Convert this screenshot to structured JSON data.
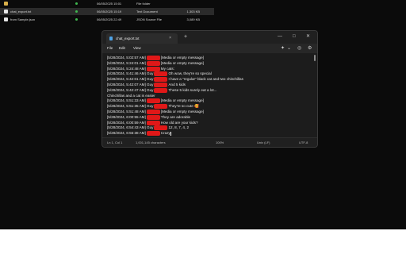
{
  "explorer": {
    "files": [
      {
        "name": "",
        "date": "06/05/2025 15:01",
        "type": "File folder",
        "size": "",
        "icon": "folder-icon",
        "icon_color": "#d9b04a"
      },
      {
        "name": "chat_export.txt",
        "date": "06/05/2025 15:19",
        "type": "Text Document",
        "size": "1,303 KB",
        "icon": "text-file-icon",
        "icon_color": "#e6e6e6"
      },
      {
        "name": "from Sample.json",
        "date": "06/05/2025 22:49",
        "type": "JSON Source File",
        "size": "3,089 KB",
        "icon": "json-file-icon",
        "icon_color": "#e6e6e6"
      }
    ]
  },
  "notepad": {
    "tab_title": "chat_export.txt",
    "tab_close": "×",
    "new_tab": "+",
    "window_controls": {
      "minimize": "—",
      "maximize": "□",
      "close": "✕"
    },
    "menu": {
      "file": "File",
      "edit": "Edit",
      "view": "View"
    },
    "menu_icons": {
      "ai": "✦",
      "dropdown": "⌄",
      "layers": "◎",
      "settings": "⚙"
    },
    "lines": [
      {
        "prefix": "[5/28/2024, 5:02:57 AM]",
        "suffix": "[Media or empty message]"
      },
      {
        "prefix": "[5/28/2024, 5:24:01 AM]",
        "suffix": "[Media or empty message]"
      },
      {
        "prefix": "[5/28/2024, 5:24:48 AM]",
        "suffix": "My cats:"
      },
      {
        "prefix": "[5/28/2024, 5:41:46 AM] Guy",
        "suffix": "Oh wow, they're so special"
      },
      {
        "prefix": "[5/28/2024, 5:42:01 AM] Guy",
        "suffix": "I have a \"regular\" black cat and two chinchillas"
      },
      {
        "prefix": "[5/28/2024, 5:42:07 AM] Guy",
        "suffix": "And 5 kids"
      },
      {
        "prefix": "[5/28/2024, 5:42:47 AM] Guy",
        "suffix": "These 5 kids surely eat a lot..."
      },
      {
        "prefix": "Chinchillas and a cat is easier",
        "suffix": ""
      },
      {
        "prefix": "[5/28/2024, 5:51:33 AM]",
        "suffix": "[Media or empty message]"
      },
      {
        "prefix": "[5/28/2024, 5:51:35 AM] Guy",
        "suffix": "They're so cute 🥰"
      },
      {
        "prefix": "[5/28/2024, 5:51:48 AM]",
        "suffix": "[Media or empty message]"
      },
      {
        "prefix": "[5/28/2024, 6:00:55 AM]",
        "suffix": "They are adorable"
      },
      {
        "prefix": "[5/28/2024, 6:00:59 AM]",
        "suffix": "How old are your kids?"
      },
      {
        "prefix": "[5/28/2024, 6:54:43 AM] Guy",
        "suffix": "12, 8, 7, 4, 2"
      },
      {
        "prefix": "[5/28/2024, 6:55:38 AM]",
        "suffix": "Crazy"
      }
    ],
    "status": {
      "position": "Ln 1, Col 1",
      "characters": "1,001,145 characters",
      "zoom": "100%",
      "line_ending": "Unix (LF)",
      "encoding": "UTF-8"
    }
  }
}
